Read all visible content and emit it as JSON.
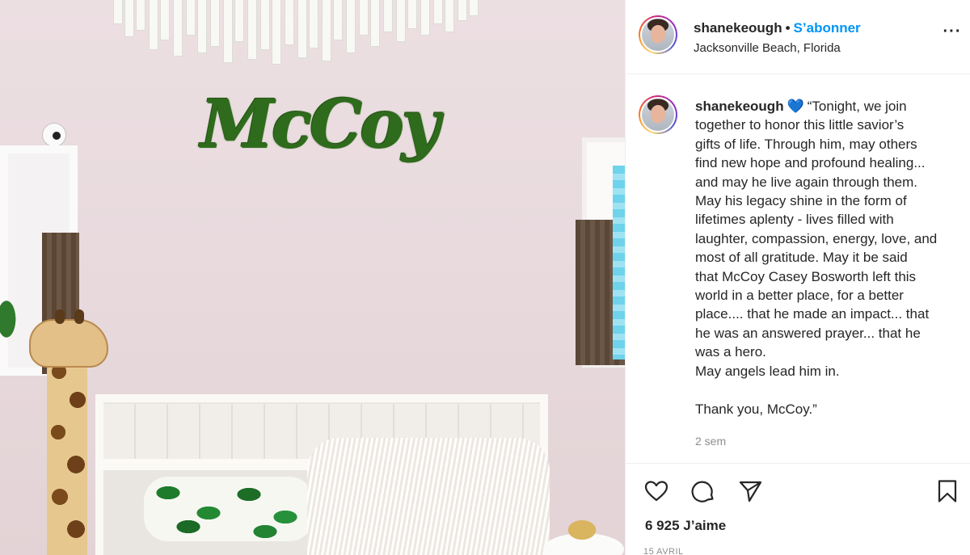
{
  "post": {
    "username": "shanekeough",
    "follow_label": "S’abonner",
    "separator": "•",
    "location": "Jacksonville Beach, Florida",
    "more_label": "···"
  },
  "photo": {
    "sign_text": "McCoy"
  },
  "caption": {
    "username": "shanekeough",
    "emoji": "💙",
    "lines": [
      "“Tonight, we join",
      "together to honor this little savior’s",
      "gifts of life. Through him, may others",
      "find new hope and profound healing...",
      "and may he live again through them.",
      "May his legacy shine in the form of",
      "lifetimes aplenty - lives filled with",
      "laughter, compassion, energy, love, and",
      "most of all gratitude. May it be said",
      "that McCoy Casey Bosworth left this",
      "world in a better place, for a better",
      "place.... that he made an impact... that",
      "he was an answered prayer... that he",
      "was a hero.",
      "May angels lead him in.",
      " ",
      "Thank you, McCoy.”"
    ],
    "time_ago": "2 sem"
  },
  "actions": {
    "icons": [
      "heart-icon",
      "comment-icon",
      "share-icon",
      "bookmark-icon"
    ],
    "likes": "6 925 J’aime",
    "date": "15 AVRIL"
  },
  "colors": {
    "follow": "#0095f6",
    "text": "#262626",
    "secondary": "#8e8e8e",
    "sign_green": "#2f6b1c"
  }
}
